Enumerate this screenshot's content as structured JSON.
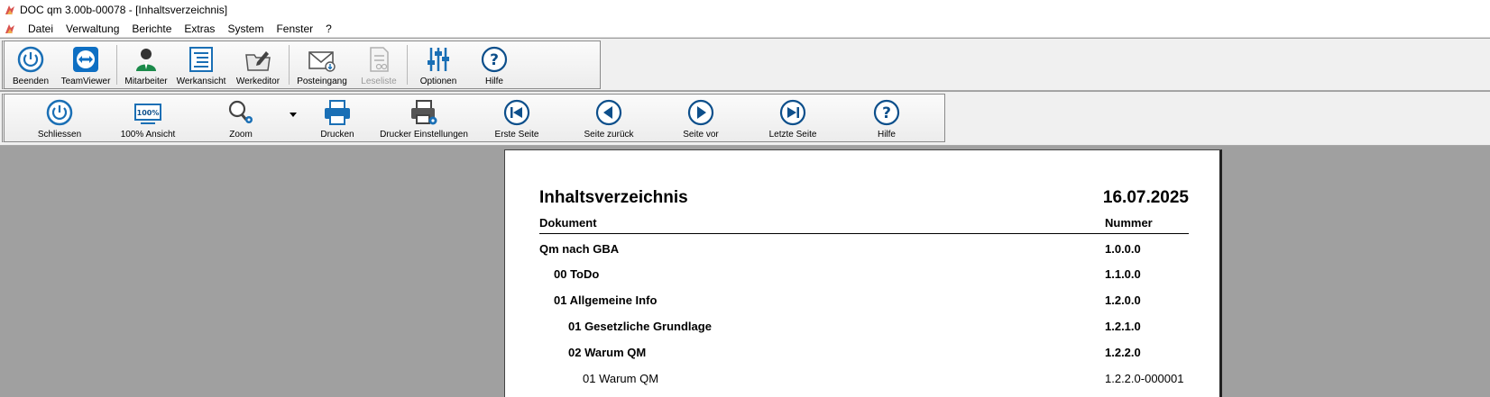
{
  "window": {
    "title": "DOC qm 3.00b-00078 - [Inhaltsverzeichnis]"
  },
  "menu": [
    "Datei",
    "Verwaltung",
    "Berichte",
    "Extras",
    "System",
    "Fenster",
    "?"
  ],
  "toolbar1": {
    "beenden": "Beenden",
    "teamviewer": "TeamViewer",
    "mitarbeiter": "Mitarbeiter",
    "werkansicht": "Werkansicht",
    "werkeditor": "Werkeditor",
    "posteingang": "Posteingang",
    "leseliste": "Leseliste",
    "optionen": "Optionen",
    "hilfe": "Hilfe"
  },
  "toolbar2": {
    "schliessen": "Schliessen",
    "ansicht100": "100% Ansicht",
    "zoom": "Zoom",
    "drucken": "Drucken",
    "drucker_einstellungen": "Drucker Einstellungen",
    "erste_seite": "Erste Seite",
    "seite_zurueck": "Seite zurück",
    "seite_vor": "Seite vor",
    "letzte_seite": "Letzte Seite",
    "hilfe": "Hilfe",
    "ansicht_icon_text": "100%"
  },
  "report": {
    "title": "Inhaltsverzeichnis",
    "date": "16.07.2025",
    "col_document": "Dokument",
    "col_number": "Nummer",
    "rows": [
      {
        "title": "Qm nach GBA",
        "number": "1.0.0.0"
      },
      {
        "title": "00 ToDo",
        "number": "1.1.0.0"
      },
      {
        "title": "01 Allgemeine Info",
        "number": "1.2.0.0"
      },
      {
        "title": "01 Gesetzliche Grundlage",
        "number": "1.2.1.0"
      },
      {
        "title": "02 Warum QM",
        "number": "1.2.2.0"
      },
      {
        "title": "01 Warum QM",
        "number": "1.2.2.0-000001"
      }
    ]
  },
  "colors": {
    "accent": "#1a6fb5",
    "accent_dark": "#0d4f8b",
    "page_bg": "#a0a0a0"
  }
}
